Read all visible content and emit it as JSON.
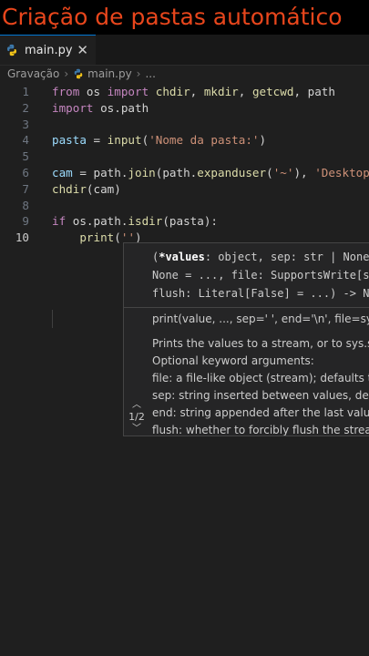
{
  "banner": {
    "title": "Criação de pastas automático"
  },
  "tabs": [
    {
      "label": "main.py",
      "close": "✕"
    }
  ],
  "breadcrumb": {
    "folder": "Gravação",
    "file": "main.py",
    "more": "..."
  },
  "editor": {
    "lines": [
      {
        "num": "1",
        "tokens": [
          [
            "kw",
            "from "
          ],
          [
            "pl",
            "os "
          ],
          [
            "kw",
            "import "
          ],
          [
            "fn",
            "chdir"
          ],
          [
            "pl",
            ", "
          ],
          [
            "fn",
            "mkdir"
          ],
          [
            "pl",
            ", "
          ],
          [
            "fn",
            "getcwd"
          ],
          [
            "pl",
            ", "
          ],
          [
            "pl",
            "path"
          ]
        ]
      },
      {
        "num": "2",
        "tokens": [
          [
            "kw",
            "import "
          ],
          [
            "pl",
            "os.path"
          ]
        ]
      },
      {
        "num": "3",
        "tokens": []
      },
      {
        "num": "4",
        "tokens": [
          [
            "vr",
            "pasta"
          ],
          [
            "pl",
            " = "
          ],
          [
            "fn",
            "input"
          ],
          [
            "pl",
            "("
          ],
          [
            "st",
            "'Nome da pasta:'"
          ],
          [
            "pl",
            ")"
          ]
        ]
      },
      {
        "num": "5",
        "tokens": []
      },
      {
        "num": "6",
        "tokens": [
          [
            "vr",
            "cam"
          ],
          [
            "pl",
            " = "
          ],
          [
            "pl",
            "path."
          ],
          [
            "fn",
            "join"
          ],
          [
            "pl",
            "(path."
          ],
          [
            "fn",
            "expanduser"
          ],
          [
            "pl",
            "("
          ],
          [
            "st",
            "'~'"
          ],
          [
            "pl",
            "), "
          ],
          [
            "st",
            "'Desktop'"
          ],
          [
            "pl",
            ")"
          ]
        ]
      },
      {
        "num": "7",
        "tokens": [
          [
            "fn",
            "chdir"
          ],
          [
            "pl",
            "(cam)"
          ]
        ]
      },
      {
        "num": "8",
        "tokens": []
      },
      {
        "num": "9",
        "tokens": [
          [
            "kw",
            "if "
          ],
          [
            "pl",
            "os.path."
          ],
          [
            "fn",
            "isdir"
          ],
          [
            "pl",
            "(pasta):"
          ]
        ]
      },
      {
        "num": "10",
        "tokens": [
          [
            "pl",
            "    "
          ],
          [
            "fn",
            "print"
          ],
          [
            "pl",
            "("
          ],
          [
            "st",
            "''"
          ],
          [
            "pl",
            ")"
          ]
        ]
      }
    ],
    "active_line": "10"
  },
  "signature_help": {
    "sig_line1_prefix": "(",
    "sig_param_active": "*values",
    "sig_line1_rest": ": object, sep: str | None",
    "sig_line2": "None = ..., file: SupportsWrite[s",
    "sig_line3": "flush: Literal[False] = ...) -> N",
    "print_signature": "print(value, ..., sep=' ', end='\\n', file=sys.st",
    "doc_lines": [
      "Prints the values to a stream, or to sys.std",
      "Optional keyword arguments:",
      "file: a file-like object (stream); defaults to",
      "sep: string inserted between values, defau",
      "end: string appended after the last value,",
      "flush: whether to forcibly flush the stream"
    ],
    "overload_counter": "1/2"
  }
}
